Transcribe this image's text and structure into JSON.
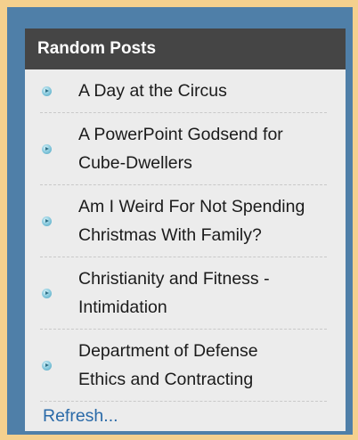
{
  "colors": {
    "page_background": "#f4d08e",
    "frame_border": "#4f7fa8",
    "header_background": "#454545",
    "widget_background": "#ececec",
    "link_accent": "#2a6aa8"
  },
  "widget": {
    "title": "Random Posts",
    "bullet_icon": "play-bullet-icon",
    "posts": [
      {
        "lines": [
          "A Day at the Circus"
        ]
      },
      {
        "lines": [
          "A PowerPoint Godsend for",
          "Cube-Dwellers"
        ]
      },
      {
        "lines": [
          "Am I Weird For Not Spending",
          "Christmas With Family?"
        ]
      },
      {
        "lines": [
          "Christianity and Fitness -",
          "Intimidation"
        ]
      },
      {
        "lines": [
          "Department of Defense",
          "Ethics and Contracting"
        ]
      }
    ],
    "refresh_label": "Refresh..."
  }
}
